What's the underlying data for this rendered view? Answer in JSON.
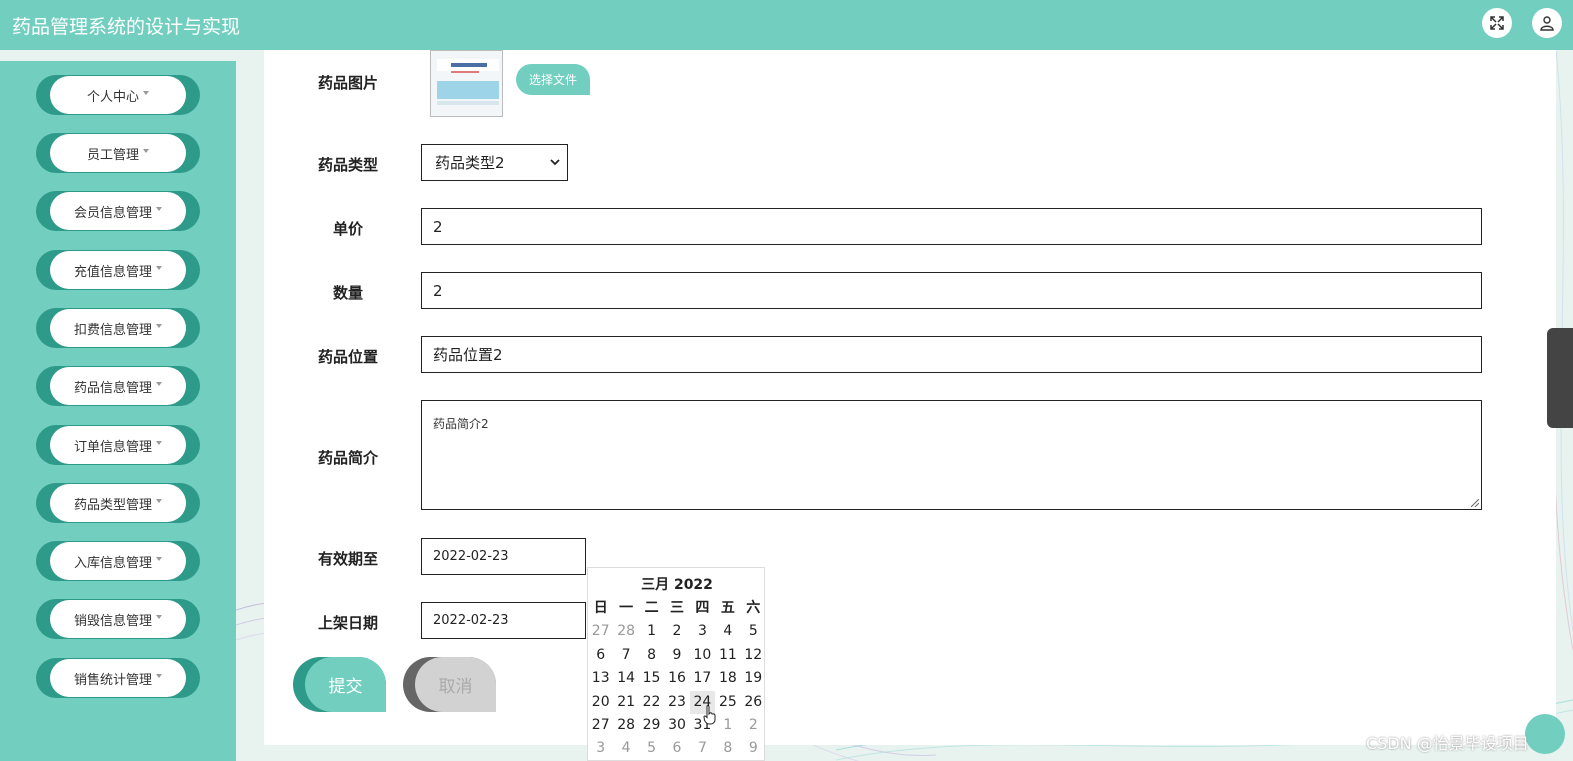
{
  "header": {
    "title": "药品管理系统的设计与实现",
    "icons": [
      "fullscreen-icon",
      "user-icon"
    ],
    "accent_color": "#72cfc0"
  },
  "sidebar": {
    "items": [
      {
        "label": "个人中心"
      },
      {
        "label": "员工管理"
      },
      {
        "label": "会员信息管理"
      },
      {
        "label": "充值信息管理"
      },
      {
        "label": "扣费信息管理"
      },
      {
        "label": "药品信息管理"
      },
      {
        "label": "订单信息管理"
      },
      {
        "label": "药品类型管理"
      },
      {
        "label": "入库信息管理"
      },
      {
        "label": "销毁信息管理"
      },
      {
        "label": "销售统计管理"
      }
    ]
  },
  "form": {
    "image_label": "药品图片",
    "choose_file_label": "选择文件",
    "type_label": "药品类型",
    "type_value": "药品类型2",
    "price_label": "单价",
    "price_value": "2",
    "quantity_label": "数量",
    "quantity_value": "2",
    "location_label": "药品位置",
    "location_value": "药品位置2",
    "intro_label": "药品简介",
    "intro_value": "药品简介2",
    "expiry_label": "有效期至",
    "expiry_value": "2022-02-23",
    "shelf_label": "上架日期",
    "shelf_value": "2022-02-23",
    "submit_label": "提交",
    "cancel_label": "取消"
  },
  "calendar": {
    "title": "三月 2022",
    "weekdays": [
      "日",
      "一",
      "二",
      "三",
      "四",
      "五",
      "六"
    ],
    "weeks": [
      [
        "27",
        "28",
        "1",
        "2",
        "3",
        "4",
        "5"
      ],
      [
        "6",
        "7",
        "8",
        "9",
        "10",
        "11",
        "12"
      ],
      [
        "13",
        "14",
        "15",
        "16",
        "17",
        "18",
        "19"
      ],
      [
        "20",
        "21",
        "22",
        "23",
        "24",
        "25",
        "26"
      ],
      [
        "27",
        "28",
        "29",
        "30",
        "31",
        "1",
        "2"
      ],
      [
        "3",
        "4",
        "5",
        "6",
        "7",
        "8",
        "9"
      ]
    ],
    "hovered_day": "24"
  },
  "watermark": "CSDN @怡景毕设项目"
}
